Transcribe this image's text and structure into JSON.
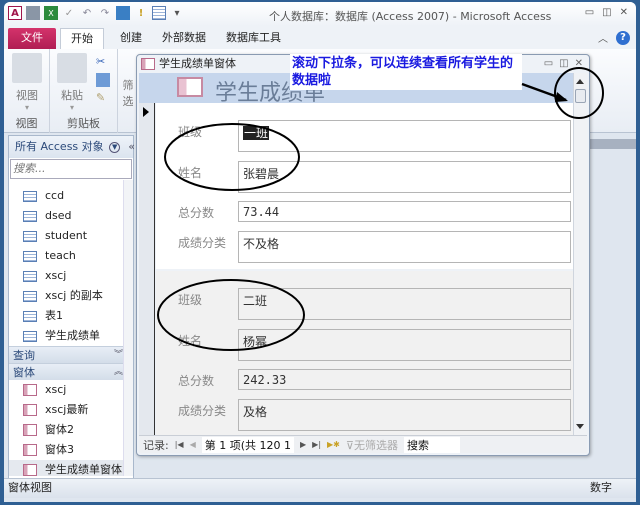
{
  "window": {
    "title": "个人数据库：数据库 (Access 2007)  -  Microsoft Access",
    "controls": [
      "minimize",
      "restore",
      "close"
    ]
  },
  "qat": {
    "icons": [
      "access-logo-icon",
      "save-icon",
      "excel-icon",
      "checkmark-icon",
      "undo-icon",
      "redo-icon",
      "image-icon",
      "exclamation-icon",
      "table-icon",
      "customize-icon"
    ],
    "access_logo": "A"
  },
  "ribbon": {
    "tabs": [
      {
        "label": "文件",
        "active": false
      },
      {
        "label": "开始",
        "active": true
      },
      {
        "label": "创建",
        "active": false
      },
      {
        "label": "外部数据",
        "active": false
      },
      {
        "label": "数据库工具",
        "active": false
      }
    ],
    "groups": [
      {
        "label": "视图",
        "buttons": [
          {
            "label": "视图"
          }
        ]
      },
      {
        "label": "剪贴板",
        "buttons": [
          {
            "label": "粘贴"
          }
        ]
      },
      {
        "label": "",
        "buttons": [
          {
            "label": "筛选"
          }
        ]
      }
    ],
    "help": "?"
  },
  "nav": {
    "header": "所有 Access 对象",
    "search_placeholder": "搜索...",
    "tables": [
      "ccd",
      "dsed",
      "student",
      "teach",
      "xscj",
      "xscj 的副本",
      "表1",
      "学生成绩单"
    ],
    "groups": [
      {
        "label": "查询",
        "expanded": false
      },
      {
        "label": "窗体",
        "expanded": true
      }
    ],
    "forms": [
      "xscj",
      "xscj最新",
      "窗体2",
      "窗体3",
      "学生成绩单窗体"
    ],
    "selected_form": "学生成绩单窗体"
  },
  "form": {
    "window_title": "学生成绩单窗体",
    "header_title": "学生成绩单",
    "labels": {
      "class": "班级",
      "name": "姓名",
      "total": "总分数",
      "category": "成绩分类"
    },
    "records": [
      {
        "class": "一班",
        "name": "张碧晨",
        "total": "73.44",
        "category": "不及格"
      },
      {
        "class": "二班",
        "name": "杨幂",
        "total": "242.33",
        "category": "及格"
      }
    ],
    "record_nav": {
      "label": "记录:",
      "position": "第 1 项(共 120 1",
      "filter": "无筛选器",
      "search": "搜索"
    }
  },
  "annotation": {
    "text": "滚动下拉条，可以连续查看所有学生的数据啦",
    "color": "#1a1ae0"
  },
  "status": {
    "left": "窗体视图",
    "right": "数字"
  },
  "colors": {
    "file_tab": "#b01e53",
    "form_header": "#c6d6ec",
    "frame": "#2f5f93"
  }
}
